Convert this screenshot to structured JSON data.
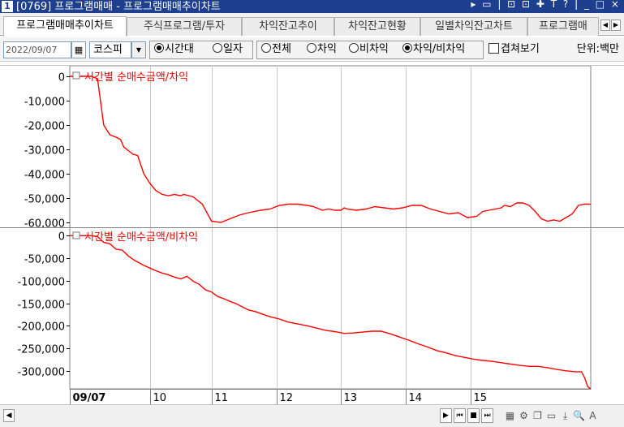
{
  "window": {
    "number": "1",
    "title": "[0769] 프로그램매매 - 프로그램매매추이차트",
    "controls": "▸ ▭ | ⊡ ⊡ ✚ T ? | _ □ ×"
  },
  "tabs": [
    {
      "label": "프로그램매매추이차트",
      "active": true
    },
    {
      "label": "주식프로그램/투자",
      "active": false
    },
    {
      "label": "차익잔고추이",
      "active": false
    },
    {
      "label": "차익잔고현황",
      "active": false
    },
    {
      "label": "일별차익잔고차트",
      "active": false
    },
    {
      "label": "프로그램매",
      "active": false
    }
  ],
  "tab_nav": {
    "prev": "◀",
    "next": "▶"
  },
  "toolbar": {
    "date": "2022/09/07",
    "calendar_icon": "calendar-icon",
    "market": "코스피",
    "period_options": [
      {
        "label": "시간대",
        "selected": true
      },
      {
        "label": "일자",
        "selected": false
      }
    ],
    "type_options": [
      {
        "label": "전체",
        "selected": false
      },
      {
        "label": "차익",
        "selected": false
      },
      {
        "label": "비차익",
        "selected": false
      },
      {
        "label": "차익/비차익",
        "selected": true
      }
    ],
    "overlay_label": "겹쳐보기",
    "overlay_checked": false,
    "unit": "단위:백만"
  },
  "chart_data": [
    {
      "type": "line",
      "title": "시간별 순매수금액/차익",
      "ylim": [
        -62000,
        3000
      ],
      "yticks": [
        "0",
        "-10,000",
        "-20,000",
        "-30,000",
        "-40,000",
        "-50,000",
        "-60,000"
      ],
      "ytick_values": [
        0,
        -10000,
        -20000,
        -30000,
        -40000,
        -50000,
        -60000
      ],
      "x": [
        0,
        3,
        4,
        5,
        7,
        9,
        11,
        13,
        15,
        16.5,
        17.5,
        19.5,
        20.5,
        22,
        24,
        26,
        28,
        30,
        32,
        34,
        35,
        36,
        37,
        40,
        43,
        46,
        49,
        52,
        55,
        58,
        62,
        65,
        68,
        71,
        74,
        77,
        79,
        80,
        82,
        84,
        86,
        88,
        89,
        90,
        93,
        96,
        99,
        102,
        105,
        108,
        111,
        114,
        117,
        120,
        123,
        126,
        129,
        132,
        134,
        136,
        138,
        140,
        141,
        143,
        145,
        147,
        149,
        151,
        153,
        155,
        157,
        159,
        161,
        163,
        165,
        167,
        169
      ],
      "series": [
        {
          "color": "#ff0000",
          "values": [
            0,
            0,
            0,
            0,
            0,
            -1000,
            -20000,
            -24000,
            -25000,
            -26000,
            -29000,
            -31000,
            -32000,
            -32500,
            -40000,
            -44000,
            -47000,
            -48500,
            -49000,
            -48500,
            -48800,
            -49000,
            -48500,
            -49500,
            -52500,
            -59500,
            -60000,
            -58500,
            -57000,
            -56000,
            -55000,
            -54500,
            -53000,
            -52500,
            -52500,
            -53000,
            -53500,
            -54000,
            -55000,
            -54500,
            -55000,
            -55000,
            -54000,
            -54500,
            -55000,
            -54500,
            -53500,
            -54000,
            -54500,
            -54000,
            -53000,
            -53000,
            -54500,
            -55500,
            -56500,
            -56000,
            -58000,
            -57500,
            -55500,
            -55000,
            -54500,
            -54000,
            -53000,
            -53500,
            -52000,
            -52000,
            -53000,
            -55500,
            -58500,
            -59500,
            -59000,
            -59500,
            -58000,
            -56500,
            -53000,
            -52500,
            -52500
          ]
        }
      ]
    },
    {
      "type": "line",
      "title": "시간별 순매수금액/비차익",
      "ylim": [
        -340000,
        15000
      ],
      "yticks": [
        "0",
        "-50,000",
        "-100,000",
        "-150,000",
        "-200,000",
        "-250,000",
        "-300,000"
      ],
      "ytick_values": [
        0,
        -50000,
        -100000,
        -150000,
        -200000,
        -250000,
        -300000
      ],
      "x": [
        0,
        3,
        4,
        5,
        7,
        9,
        11,
        13,
        15,
        17,
        19,
        21,
        24,
        26,
        28,
        30,
        32,
        34,
        36,
        38,
        40,
        42,
        44,
        46,
        48,
        50,
        52,
        54,
        56,
        58,
        60,
        62,
        65,
        68,
        71,
        74,
        77,
        80,
        83,
        86,
        89,
        92,
        95,
        98,
        101,
        104,
        107,
        110,
        113,
        116,
        119,
        122,
        125,
        128,
        131,
        134,
        137,
        140,
        143,
        146,
        149,
        152,
        155,
        158,
        161,
        164,
        166,
        167,
        168,
        169
      ],
      "series": [
        {
          "color": "#ff0000",
          "values": [
            0,
            0,
            0,
            0,
            0,
            -2000,
            -15000,
            -18000,
            -30000,
            -32000,
            -45000,
            -55000,
            -66000,
            -72000,
            -78000,
            -83000,
            -87000,
            -92000,
            -96000,
            -90000,
            -101000,
            -108000,
            -120000,
            -125000,
            -135000,
            -140000,
            -146000,
            -151000,
            -158000,
            -165000,
            -168000,
            -173000,
            -180000,
            -185000,
            -192000,
            -196000,
            -200000,
            -205000,
            -210000,
            -213000,
            -217000,
            -216000,
            -214000,
            -212000,
            -212000,
            -218000,
            -225000,
            -232000,
            -240000,
            -247000,
            -255000,
            -260000,
            -266000,
            -270000,
            -274000,
            -277000,
            -279000,
            -282000,
            -285000,
            -288000,
            -290000,
            -290000,
            -293000,
            -297000,
            -300000,
            -302000,
            -302000,
            -315000,
            -335000,
            -340000
          ]
        }
      ]
    }
  ],
  "x_axis": {
    "labels": [
      "09/07",
      "10",
      "11",
      "12",
      "13",
      "14",
      "15"
    ],
    "label_positions": [
      0,
      26,
      46,
      67,
      88,
      109,
      130
    ]
  },
  "bottom_controls": {
    "scroll_left": "◀",
    "buttons": [
      "▶",
      "⏮",
      "■",
      "⏭"
    ],
    "icons": [
      "ruler-icon",
      "gear-icon",
      "window-icon",
      "chart-icon",
      "cursor-icon",
      "zoom-icon",
      "text-icon"
    ],
    "icon_glyphs": [
      "▦",
      "⚙",
      "❐",
      "▭",
      "⤓",
      "🔍",
      "A"
    ]
  }
}
